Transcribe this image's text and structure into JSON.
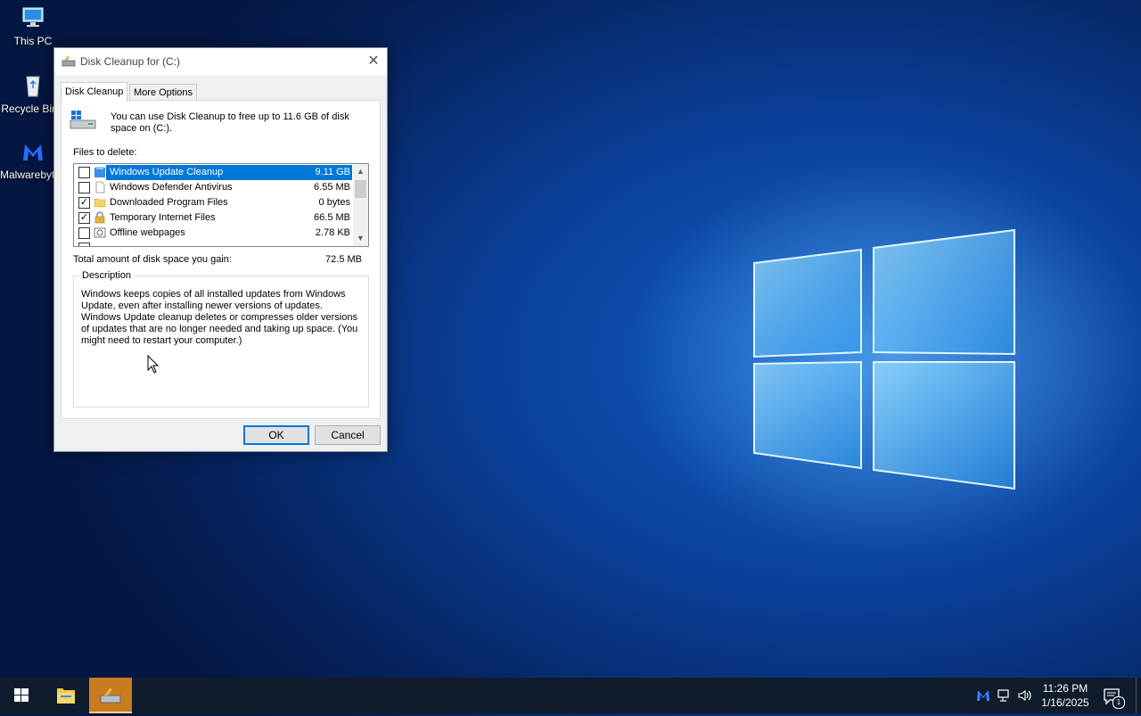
{
  "desktop": {
    "icons": [
      {
        "label": "This PC"
      },
      {
        "label": "Recycle Bin"
      },
      {
        "label": "Malwarebytes"
      }
    ]
  },
  "dialog": {
    "title": "Disk Cleanup for  (C:)",
    "tabs": [
      {
        "label": "Disk Cleanup",
        "active": true
      },
      {
        "label": "More Options",
        "active": false
      }
    ],
    "intro": "You can use Disk Cleanup to free up to 11.6 GB of disk space on  (C:).",
    "files_label": "Files to delete:",
    "files": [
      {
        "name": "Windows Update Cleanup",
        "size": "9.11 GB",
        "checked": false,
        "selected": true,
        "icon": "update-icon"
      },
      {
        "name": "Windows Defender Antivirus",
        "size": "6.55 MB",
        "checked": false,
        "selected": false,
        "icon": "file-icon"
      },
      {
        "name": "Downloaded Program Files",
        "size": "0 bytes",
        "checked": true,
        "selected": false,
        "icon": "folder-icon"
      },
      {
        "name": "Temporary Internet Files",
        "size": "66.5 MB",
        "checked": true,
        "selected": false,
        "icon": "lock-icon"
      },
      {
        "name": "Offline webpages",
        "size": "2.78 KB",
        "checked": false,
        "selected": false,
        "icon": "webpage-icon"
      }
    ],
    "total_label": "Total amount of disk space you gain:",
    "total_value": "72.5 MB",
    "description_legend": "Description",
    "description": "Windows keeps copies of all installed updates from Windows Update, even after installing newer versions of updates. Windows Update cleanup deletes or compresses older versions of updates that are no longer needed and taking up space. (You might need to restart your computer.)",
    "ok_label": "OK",
    "cancel_label": "Cancel",
    "close_glyph": "✕"
  },
  "taskbar": {
    "time": "11:26 PM",
    "date": "1/16/2025",
    "notification_count": "1"
  },
  "colors": {
    "selection": "#0078d7",
    "taskbar_active": "#c97b20"
  }
}
